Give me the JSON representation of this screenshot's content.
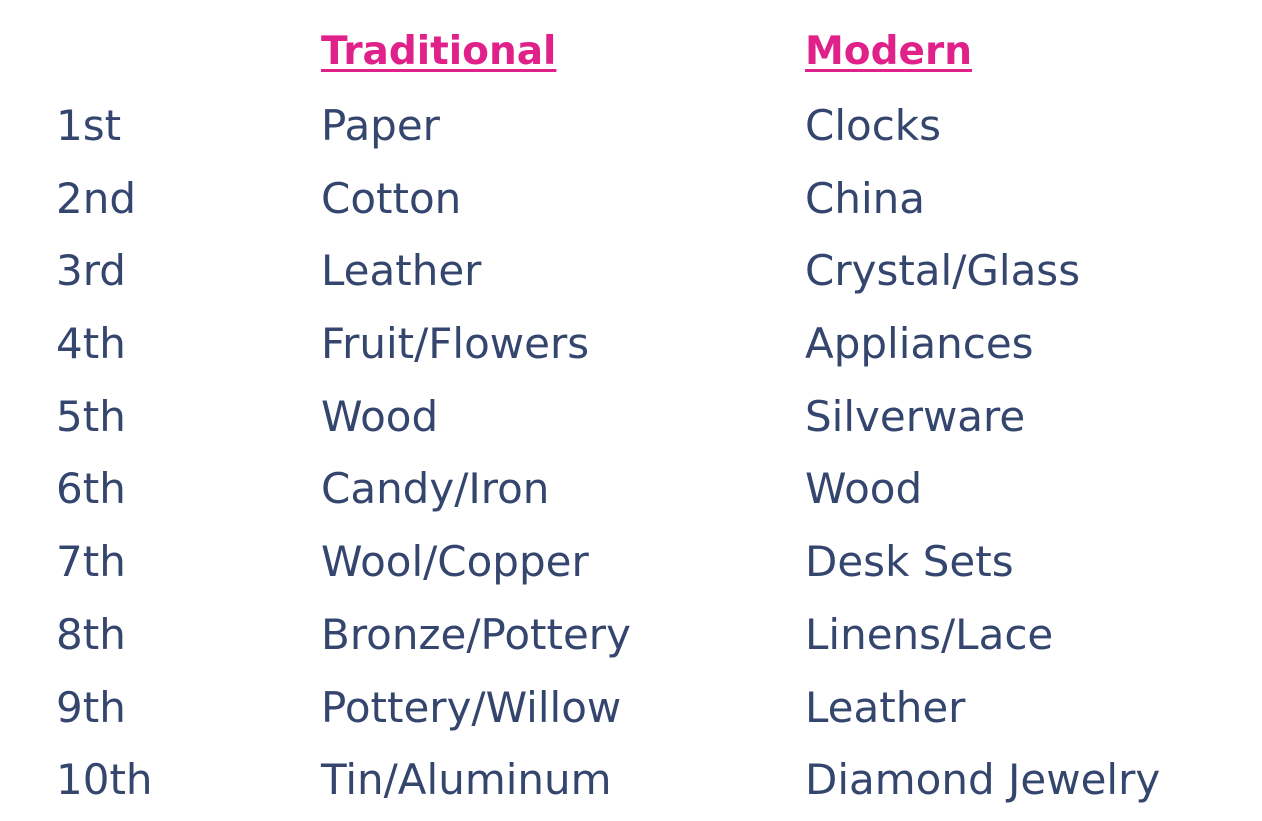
{
  "headers": {
    "year": "",
    "traditional": "Traditional",
    "modern": "Modern"
  },
  "colors": {
    "header": "#e0218a",
    "text": "#34456e"
  },
  "rows": [
    {
      "year": "1st",
      "traditional": "Paper",
      "modern": "Clocks"
    },
    {
      "year": "2nd",
      "traditional": "Cotton",
      "modern": "China"
    },
    {
      "year": "3rd",
      "traditional": "Leather",
      "modern": "Crystal/Glass"
    },
    {
      "year": "4th",
      "traditional": "Fruit/Flowers",
      "modern": "Appliances"
    },
    {
      "year": "5th",
      "traditional": "Wood",
      "modern": "Silverware"
    },
    {
      "year": "6th",
      "traditional": "Candy/Iron",
      "modern": "Wood"
    },
    {
      "year": "7th",
      "traditional": "Wool/Copper",
      "modern": "Desk Sets"
    },
    {
      "year": "8th",
      "traditional": "Bronze/Pottery",
      "modern": "Linens/Lace"
    },
    {
      "year": "9th",
      "traditional": "Pottery/Willow",
      "modern": "Leather"
    },
    {
      "year": "10th",
      "traditional": "Tin/Aluminum",
      "modern": "Diamond Jewelry"
    }
  ]
}
